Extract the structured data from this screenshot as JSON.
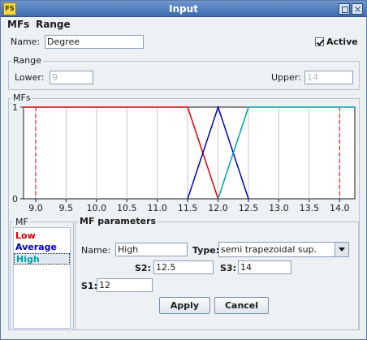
{
  "window": {
    "title": "Input",
    "app_icon_text": "FS"
  },
  "menu": {
    "items": [
      "MFs",
      "Range"
    ]
  },
  "name_row": {
    "label": "Name:",
    "value": "Degree",
    "active_label": "Active",
    "active_checked": true
  },
  "range": {
    "title": "Range",
    "lower_label": "Lower:",
    "lower_value": "9",
    "upper_label": "Upper:",
    "upper_value": "14"
  },
  "mfs_group": {
    "title": "MFs"
  },
  "chart_data": {
    "type": "line",
    "xlim": [
      8.8,
      14.25
    ],
    "ylim": [
      0,
      1
    ],
    "ytick_labels": [
      "1",
      "0"
    ],
    "xtick_labels": [
      "9.0",
      "9.5",
      "10.0",
      "10.5",
      "11.0",
      "11.5",
      "12.0",
      "12.5",
      "13.0",
      "13.5",
      "14.0"
    ],
    "range_markers": [
      9.0,
      14.0
    ],
    "series": [
      {
        "name": "Low",
        "color": "#dd0000",
        "x": [
          8.8,
          11.5,
          12.0
        ],
        "y": [
          1,
          1,
          0
        ]
      },
      {
        "name": "Average",
        "color": "#0000bb",
        "x": [
          11.5,
          12.0,
          12.5
        ],
        "y": [
          0,
          1,
          0
        ]
      },
      {
        "name": "High",
        "color": "#00a3a3",
        "x": [
          12.0,
          12.5,
          14.25
        ],
        "y": [
          0,
          1,
          1
        ]
      }
    ]
  },
  "mf_list": {
    "title": "MF",
    "items": [
      {
        "label": "Low",
        "color": "#dd0000"
      },
      {
        "label": "Average",
        "color": "#0000bb"
      },
      {
        "label": "High",
        "color": "#00a3a3"
      }
    ],
    "selected": "High"
  },
  "mf_params": {
    "title": "MF parameters",
    "name_label": "Name:",
    "name_value": "High",
    "type_label": "Type:",
    "type_value": "semi trapezoidal sup.",
    "s2_label": "S2:",
    "s2_value": "12.5",
    "s3_label": "S3:",
    "s3_value": "14",
    "s1_label": "S1:",
    "s1_value": "12",
    "apply_label": "Apply",
    "cancel_label": "Cancel"
  }
}
